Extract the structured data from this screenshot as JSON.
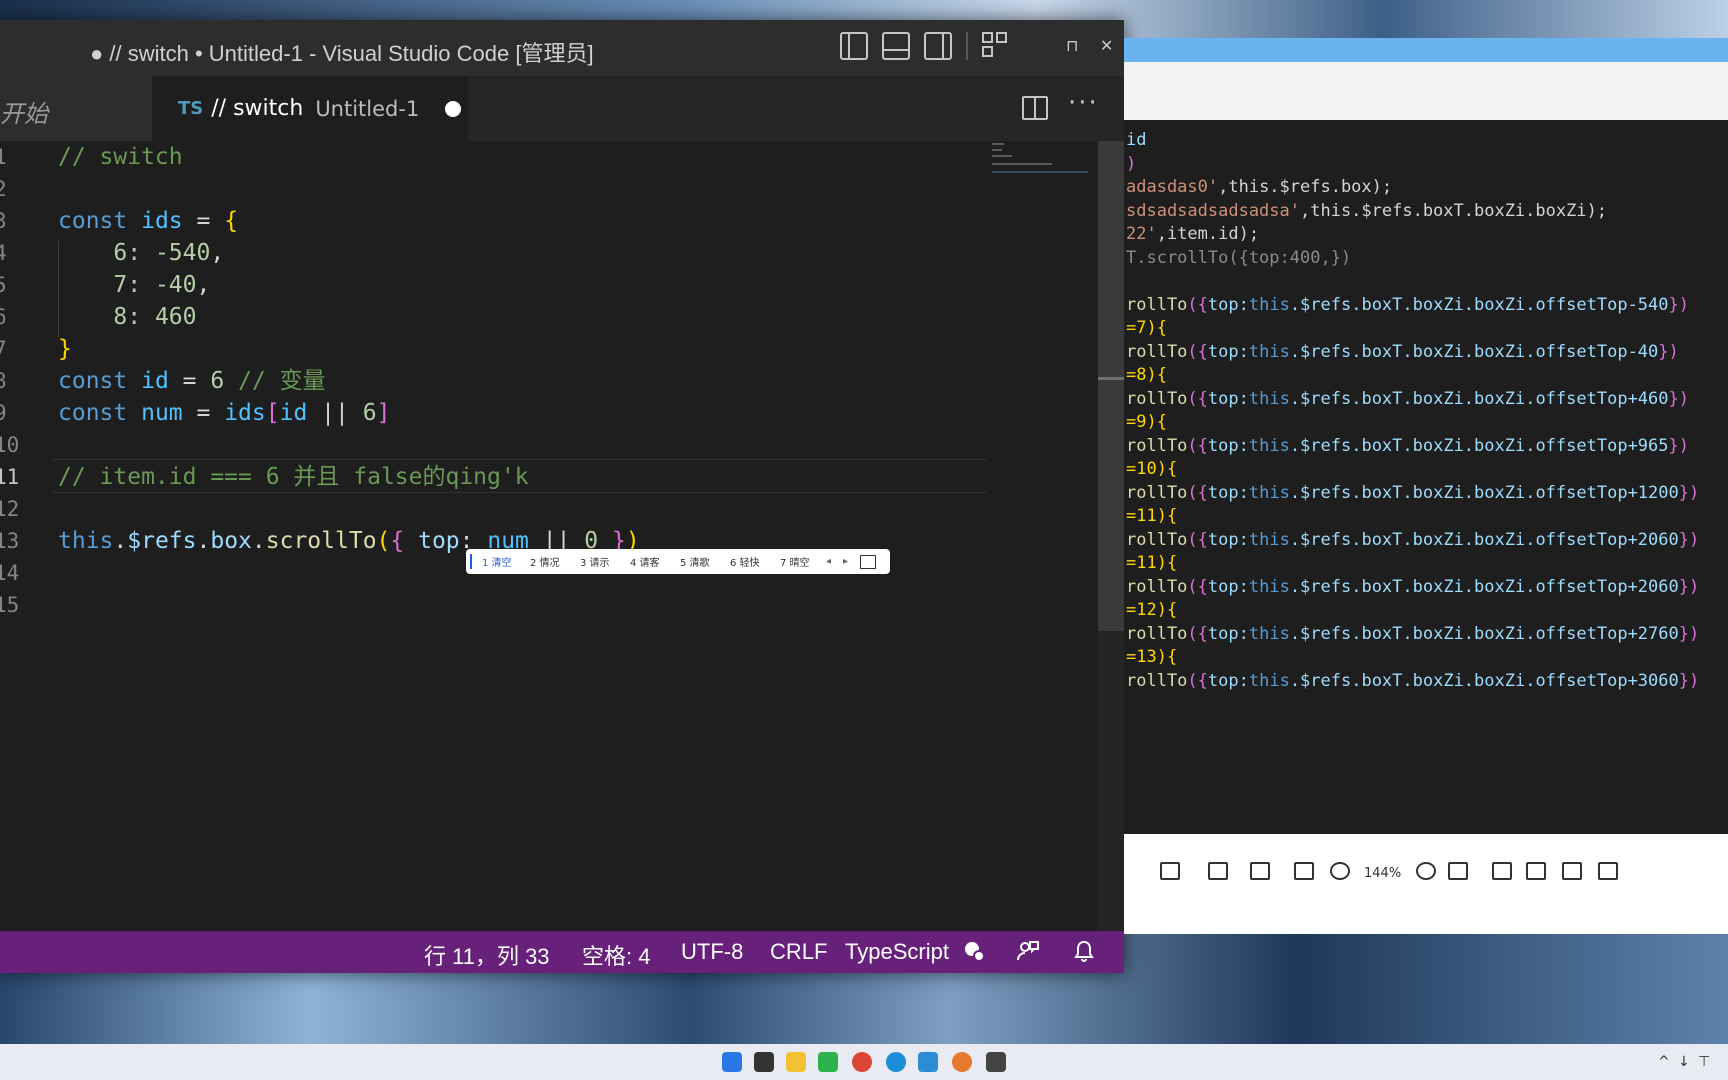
{
  "window": {
    "title": "● // switch • Untitled-1 - Visual Studio Code [管理员]",
    "minimize": "ꟷ",
    "restore": "⊓",
    "close": "✕"
  },
  "tabs": {
    "start_label": "开始",
    "active": {
      "lang_badge": "TS",
      "name": "// switch",
      "description": "Untitled-1"
    },
    "more": "···"
  },
  "editor": {
    "line_numbers": [
      "1",
      "2",
      "3",
      "4",
      "5",
      "6",
      "7",
      "8",
      "9",
      "10",
      "11",
      "12",
      "13",
      "14",
      "15"
    ],
    "current_line": "11",
    "code": {
      "l1_comment": "// switch",
      "l3_kw": "const",
      "l3_var": "ids",
      "l3_op": " = ",
      "l3_brace": "{",
      "l4_key": "6:",
      "l4_val": " -540",
      "l4_comma": ",",
      "l5_key": "7:",
      "l5_val": " -40",
      "l5_comma": ",",
      "l6_key": "8:",
      "l6_val": " 460",
      "l7_brace": "}",
      "l8_kw": "const",
      "l8_var": "id",
      "l8_op": " = ",
      "l8_num": "6",
      "l8_comment": " // 变量",
      "l9_kw": "const",
      "l9_var": "num",
      "l9_op": " = ",
      "l9_ids": "ids",
      "l9_open": "[",
      "l9_id": "id",
      "l9_or": " || ",
      "l9_num": "6",
      "l9_close": "]",
      "l11_comment": "// item.id === 6 并且 false的qing'k",
      "l13_this": "this",
      "l13_dot1": ".",
      "l13_refs": "$refs",
      "l13_dot2": ".",
      "l13_box": "box",
      "l13_dot3": ".",
      "l13_fn": "scrollTo",
      "l13_paren_open": "(",
      "l13_brace_open": "{",
      "l13_top": " top",
      "l13_colon": ": ",
      "l13_num": "num",
      "l13_or": " || ",
      "l13_zero": "0",
      "l13_brace_close": " }",
      "l13_paren_close": ")"
    }
  },
  "ime": {
    "candidates": [
      "1 清空",
      "2 情况",
      "3 请示",
      "4 请客",
      "5 清歌",
      "6 轻快",
      "7 晴空"
    ],
    "prev": "◂",
    "next": "▸"
  },
  "statusbar": {
    "position": "行 11，列 33",
    "spaces": "空格: 4",
    "encoding": "UTF-8",
    "eol": "CRLF",
    "language": "TypeScript",
    "background_color": "#68217a"
  },
  "viewer": {
    "lines": [
      {
        "parts": [
          {
            "t": "id",
            "c": "prop"
          }
        ]
      },
      {
        "parts": [
          {
            "t": ")",
            "c": "br2"
          }
        ]
      },
      {
        "parts": [
          {
            "t": "adasdas0'",
            "c": "str"
          },
          {
            "t": ",this.$refs.box);",
            "c": "white"
          }
        ]
      },
      {
        "parts": [
          {
            "t": "sdsadsadsadsadsa'",
            "c": "str"
          },
          {
            "t": ",this.$refs.boxT.boxZi.boxZi);",
            "c": "white"
          }
        ]
      },
      {
        "parts": [
          {
            "t": "22'",
            "c": "str"
          },
          {
            "t": ",item.id);",
            "c": "white"
          }
        ]
      },
      {
        "parts": [
          {
            "t": "T.scrollTo({top:400,})",
            "c": "dim"
          }
        ]
      },
      {
        "parts": [
          {
            "t": "",
            "c": "white"
          }
        ]
      },
      {
        "parts": [
          {
            "t": "rollTo",
            "c": "fn"
          },
          {
            "t": "({",
            "c": "br2"
          },
          {
            "t": "top:",
            "c": "prop"
          },
          {
            "t": "this",
            "c": "kw"
          },
          {
            "t": ".$refs.boxT.boxZi.boxZi.offsetTop-540",
            "c": "prop"
          },
          {
            "t": "})",
            "c": "br2"
          }
        ]
      },
      {
        "parts": [
          {
            "t": "=7){",
            "c": "br"
          }
        ]
      },
      {
        "parts": [
          {
            "t": "rollTo",
            "c": "fn"
          },
          {
            "t": "({",
            "c": "br2"
          },
          {
            "t": "top:",
            "c": "prop"
          },
          {
            "t": "this",
            "c": "kw"
          },
          {
            "t": ".$refs.boxT.boxZi.boxZi.offsetTop-40",
            "c": "prop"
          },
          {
            "t": "})",
            "c": "br2"
          }
        ]
      },
      {
        "parts": [
          {
            "t": "=8){",
            "c": "br"
          }
        ]
      },
      {
        "parts": [
          {
            "t": "rollTo",
            "c": "fn"
          },
          {
            "t": "({",
            "c": "br2"
          },
          {
            "t": "top:",
            "c": "prop"
          },
          {
            "t": "this",
            "c": "kw"
          },
          {
            "t": ".$refs.boxT.boxZi.boxZi.offsetTop+460",
            "c": "prop"
          },
          {
            "t": "})",
            "c": "br2"
          }
        ]
      },
      {
        "parts": [
          {
            "t": "=9){",
            "c": "br"
          }
        ]
      },
      {
        "parts": [
          {
            "t": "rollTo",
            "c": "fn"
          },
          {
            "t": "({",
            "c": "br2"
          },
          {
            "t": "top:",
            "c": "prop"
          },
          {
            "t": "this",
            "c": "kw"
          },
          {
            "t": ".$refs.boxT.boxZi.boxZi.offsetTop+965",
            "c": "prop"
          },
          {
            "t": "})",
            "c": "br2"
          }
        ]
      },
      {
        "parts": [
          {
            "t": "=10){",
            "c": "br"
          }
        ]
      },
      {
        "parts": [
          {
            "t": "rollTo",
            "c": "fn"
          },
          {
            "t": "({",
            "c": "br2"
          },
          {
            "t": "top:",
            "c": "prop"
          },
          {
            "t": "this",
            "c": "kw"
          },
          {
            "t": ".$refs.boxT.boxZi.boxZi.offsetTop+1200",
            "c": "prop"
          },
          {
            "t": "})",
            "c": "br2"
          }
        ]
      },
      {
        "parts": [
          {
            "t": "=11){",
            "c": "br"
          }
        ]
      },
      {
        "parts": [
          {
            "t": "rollTo",
            "c": "fn"
          },
          {
            "t": "({",
            "c": "br2"
          },
          {
            "t": "top:",
            "c": "prop"
          },
          {
            "t": "this",
            "c": "kw"
          },
          {
            "t": ".$refs.boxT.boxZi.boxZi.offsetTop+2060",
            "c": "prop"
          },
          {
            "t": "})",
            "c": "br2"
          }
        ]
      },
      {
        "parts": [
          {
            "t": "=11){",
            "c": "br"
          }
        ]
      },
      {
        "parts": [
          {
            "t": "rollTo",
            "c": "fn"
          },
          {
            "t": "({",
            "c": "br2"
          },
          {
            "t": "top:",
            "c": "prop"
          },
          {
            "t": "this",
            "c": "kw"
          },
          {
            "t": ".$refs.boxT.boxZi.boxZi.offsetTop+2060",
            "c": "prop"
          },
          {
            "t": "})",
            "c": "br2"
          }
        ]
      },
      {
        "parts": [
          {
            "t": "=12){",
            "c": "br"
          }
        ]
      },
      {
        "parts": [
          {
            "t": "rollTo",
            "c": "fn"
          },
          {
            "t": "({",
            "c": "br2"
          },
          {
            "t": "top:",
            "c": "prop"
          },
          {
            "t": "this",
            "c": "kw"
          },
          {
            "t": ".$refs.boxT.boxZi.boxZi.offsetTop+2760",
            "c": "prop"
          },
          {
            "t": "})",
            "c": "br2"
          }
        ]
      },
      {
        "parts": [
          {
            "t": "=13){",
            "c": "br"
          }
        ]
      },
      {
        "parts": [
          {
            "t": "rollTo",
            "c": "fn"
          },
          {
            "t": "({",
            "c": "br2"
          },
          {
            "t": "top:",
            "c": "prop"
          },
          {
            "t": "this",
            "c": "kw"
          },
          {
            "t": ".$refs.boxT.boxZi.boxZi.offsetTop+3060",
            "c": "prop"
          },
          {
            "t": "})",
            "c": "br2"
          }
        ]
      }
    ],
    "zoom": "144%",
    "toolbar_icons": [
      "save-layout-icon",
      "fit-icon",
      "copy-icon",
      "fullscreen-icon",
      "zoom-out-icon",
      "zoom-in-icon",
      "original-size-icon",
      "rotate-icon",
      "open-external-icon",
      "crop-icon",
      "download-icon"
    ]
  },
  "taskbar": {
    "icons": [
      "windows-start-icon",
      "task-view-icon",
      "file-explorer-icon",
      "wechat-icon",
      "chrome-icon",
      "edge-icon",
      "vscode-icon",
      "app-icon",
      "terminal-icon"
    ],
    "tray": [
      "^",
      "↓",
      "⊤"
    ]
  }
}
